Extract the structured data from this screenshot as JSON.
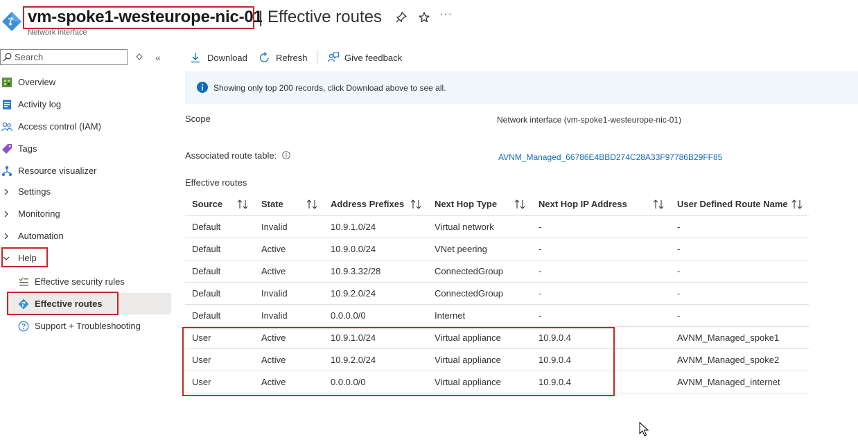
{
  "header": {
    "resource_name": "vm-spoke1-westeurope-nic-01",
    "separator": "|",
    "page_title": "Effective routes",
    "resource_type": "Network interface",
    "more": "···"
  },
  "search": {
    "placeholder": "Search"
  },
  "sidebar": {
    "items": [
      {
        "label": "Overview"
      },
      {
        "label": "Activity log"
      },
      {
        "label": "Access control (IAM)"
      },
      {
        "label": "Tags"
      },
      {
        "label": "Resource visualizer"
      },
      {
        "label": "Settings"
      },
      {
        "label": "Monitoring"
      },
      {
        "label": "Automation"
      },
      {
        "label": "Help"
      }
    ],
    "help_children": [
      {
        "label": "Effective security rules"
      },
      {
        "label": "Effective routes"
      },
      {
        "label": "Support + Troubleshooting"
      }
    ]
  },
  "toolbar": {
    "download_label": "Download",
    "refresh_label": "Refresh",
    "feedback_label": "Give feedback"
  },
  "info": {
    "text": "Showing only top 200 records, click Download above to see all."
  },
  "properties": {
    "scope_label": "Scope",
    "scope_value": "Network interface (vm-spoke1-westeurope-nic-01)",
    "route_table_label": "Associated route table:",
    "route_table_value": "AVNM_Managed_66786E4BBD274C28A33F97786B29FF85"
  },
  "section_title": "Effective routes",
  "table": {
    "headers": [
      "Source",
      "State",
      "Address Prefixes",
      "Next Hop Type",
      "Next Hop IP Address",
      "User Defined Route Name"
    ],
    "rows": [
      [
        "Default",
        "Invalid",
        "10.9.1.0/24",
        "Virtual network",
        "-",
        "-"
      ],
      [
        "Default",
        "Active",
        "10.9.0.0/24",
        "VNet peering",
        "-",
        "-"
      ],
      [
        "Default",
        "Active",
        "10.9.3.32/28",
        "ConnectedGroup",
        "-",
        "-"
      ],
      [
        "Default",
        "Invalid",
        "10.9.2.0/24",
        "ConnectedGroup",
        "-",
        "-"
      ],
      [
        "Default",
        "Invalid",
        "0.0.0.0/0",
        "Internet",
        "-",
        "-"
      ],
      [
        "User",
        "Active",
        "10.9.1.0/24",
        "Virtual appliance",
        "10.9.0.4",
        "AVNM_Managed_spoke1"
      ],
      [
        "User",
        "Active",
        "10.9.2.0/24",
        "Virtual appliance",
        "10.9.0.4",
        "AVNM_Managed_spoke2"
      ],
      [
        "User",
        "Active",
        "0.0.0.0/0",
        "Virtual appliance",
        "10.9.0.4",
        "AVNM_Managed_internet"
      ]
    ]
  },
  "colors": {
    "accent": "#0f6cbd",
    "highlight_border": "#c62828",
    "info_background": "#eff6fc",
    "selected_background": "#edebe9"
  }
}
